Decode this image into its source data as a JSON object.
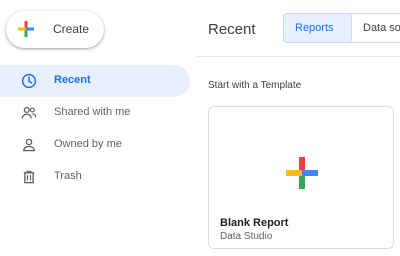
{
  "sidebar": {
    "create_label": "Create",
    "items": [
      {
        "label": "Recent",
        "icon": "clock-icon",
        "active": true
      },
      {
        "label": "Shared with me",
        "icon": "people-icon",
        "active": false
      },
      {
        "label": "Owned by me",
        "icon": "person-icon",
        "active": false
      },
      {
        "label": "Trash",
        "icon": "trash-icon",
        "active": false
      }
    ]
  },
  "main": {
    "title": "Recent",
    "tabs": [
      {
        "label": "Reports",
        "active": true
      },
      {
        "label": "Data so",
        "active": false
      }
    ],
    "template_section_label": "Start with a Template",
    "template_card": {
      "title": "Blank Report",
      "subtitle": "Data Studio",
      "icon": "plus-icon"
    }
  },
  "colors": {
    "accent": "#1a73e8",
    "active_bg": "#e8f0fe",
    "plus_blue": "#4285f4",
    "plus_red": "#ea4335",
    "plus_yellow": "#fbbc04",
    "plus_green": "#34a853"
  }
}
